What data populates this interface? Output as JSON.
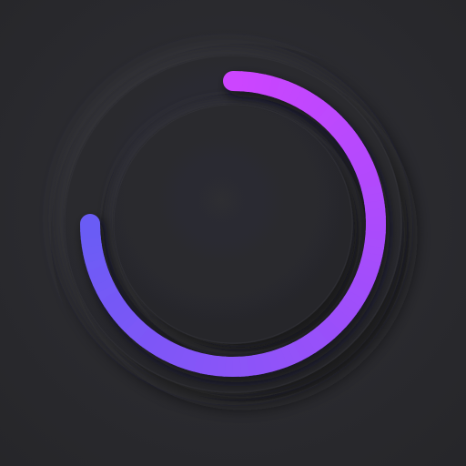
{
  "progress_ring": {
    "progress": 0.75,
    "start_angle_deg": 0,
    "gradient": {
      "start_color": "#cc44ff",
      "end_color": "#6a5cf5"
    }
  },
  "colors": {
    "background": "#2a2a2f",
    "outer_ring": "#2c2c31",
    "inner_knob": "#2a2a2f",
    "shadow_dark": "#161618",
    "shadow_light": "#3a3a40"
  }
}
